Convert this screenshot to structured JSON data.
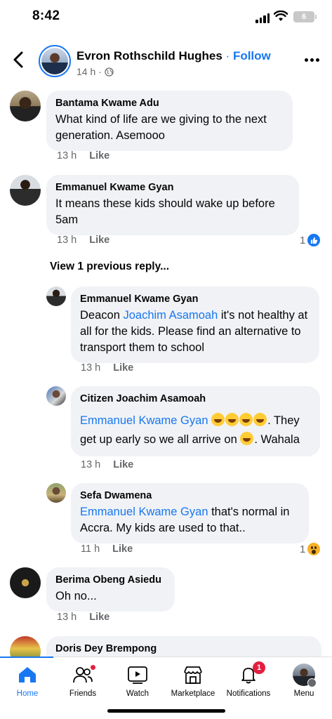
{
  "status_bar": {
    "time": "8:42",
    "battery": "6"
  },
  "header": {
    "name": "Evron Rothschild Hughes",
    "separator": "·",
    "follow": "Follow",
    "time": "14 h ·"
  },
  "comments": [
    {
      "name": "Bantama Kwame Adu",
      "text": "What kind of life are we giving to the next generation. Asemooo",
      "time": "13 h",
      "like": "Like"
    },
    {
      "name": "Emmanuel Kwame Gyan",
      "text": "It means these kids should wake up before 5am",
      "time": "13 h",
      "like": "Like",
      "reaction_count": "1"
    }
  ],
  "view_replies": "View 1 previous reply...",
  "replies": [
    {
      "name": "Emmanuel Kwame Gyan",
      "prefix": "Deacon ",
      "mention": "Joachim Asamoah",
      "text": " it's not healthy at all for the kids. Please find an alternative to transport them to school",
      "time": "13 h",
      "like": "Like"
    },
    {
      "name": "Citizen Joachim Asamoah",
      "mention": "Emmanuel Kwame Gyan",
      "text1": ". They get up early so we all arrive on ",
      "text2": ". Wahala",
      "time": "13 h",
      "like": "Like"
    },
    {
      "name": "Sefa Dwamena",
      "mention": "Emmanuel Kwame Gyan",
      "text": " that's normal in Accra. My kids are used to that..",
      "time": "11 h",
      "like": "Like",
      "reaction_count": "1"
    }
  ],
  "comments_after": [
    {
      "name": "Berima Obeng Asiedu",
      "text": "Oh no...",
      "time": "13 h",
      "like": "Like"
    },
    {
      "name": "Doris Dey Brempong"
    }
  ],
  "nav": {
    "home": "Home",
    "friends": "Friends",
    "watch": "Watch",
    "marketplace": "Marketplace",
    "notifications": "Notifications",
    "notifications_badge": "1",
    "menu": "Menu"
  },
  "colors": {
    "accent": "#1877f2",
    "bubble": "#f0f2f5",
    "badge": "#e41e3f"
  }
}
